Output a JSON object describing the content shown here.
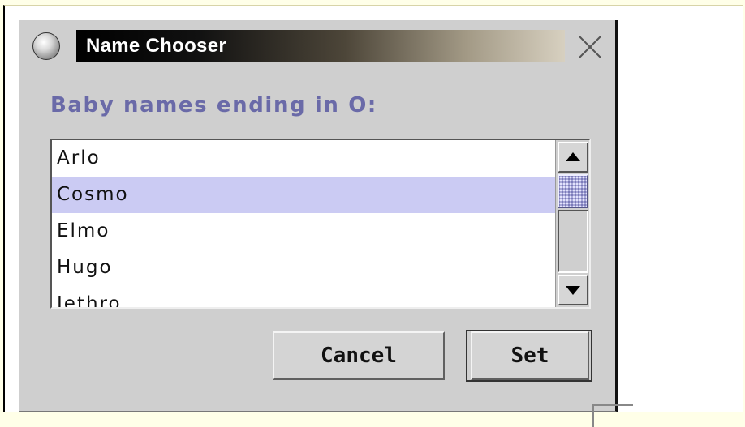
{
  "window": {
    "title": "Name Chooser",
    "icon": "window-menu-icon",
    "close_icon": "close-icon"
  },
  "prompt": {
    "label": "Baby names ending in O:",
    "color": "#6a6aa8"
  },
  "list": {
    "items": [
      {
        "label": "Arlo",
        "selected": false
      },
      {
        "label": "Cosmo",
        "selected": true
      },
      {
        "label": "Elmo",
        "selected": false
      },
      {
        "label": "Hugo",
        "selected": false
      },
      {
        "label": "Jethro",
        "selected": false
      }
    ],
    "selection_color": "#cbcbf3",
    "scroll_up_icon": "arrow-up-icon",
    "scroll_down_icon": "arrow-down-icon"
  },
  "buttons": {
    "cancel_label": "Cancel",
    "set_label": "Set"
  }
}
